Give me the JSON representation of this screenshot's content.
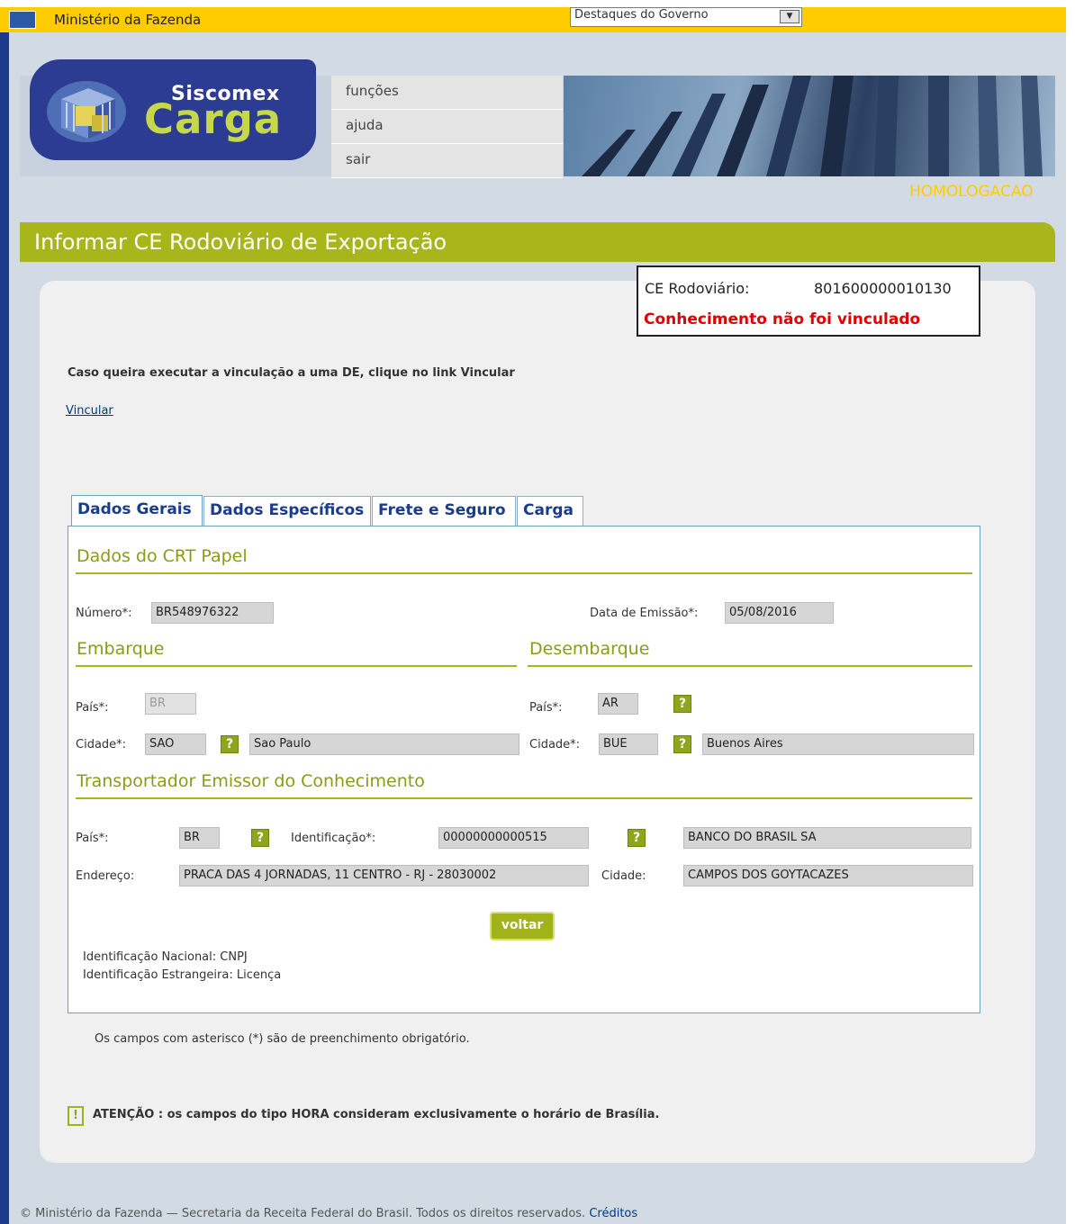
{
  "gov_bar": {
    "title": "Ministério da Fazenda",
    "select_value": "Destaques do Governo",
    "colors": {
      "bar": "#ffcc00",
      "edge": "#1e3a8a"
    }
  },
  "header": {
    "logo_line1": "Siscomex",
    "logo_line2": "Carga",
    "menu": [
      {
        "label": "funções"
      },
      {
        "label": "ajuda"
      },
      {
        "label": "sair"
      }
    ],
    "environment": "HOMOLOGACAO"
  },
  "page": {
    "title": "Informar CE Rodoviário de Exportação",
    "ce_label": "CE Rodoviário:",
    "ce_number": "801600000010130",
    "ce_status": "Conhecimento não foi vinculado",
    "info_text": "Caso queira executar a vinculação a uma DE, clique no link Vincular",
    "vincular_link": "Vincular"
  },
  "tabs": [
    {
      "label": "Dados Gerais",
      "active": true
    },
    {
      "label": "Dados Específicos",
      "active": false
    },
    {
      "label": "Frete e Seguro",
      "active": false
    },
    {
      "label": "Carga",
      "active": false
    }
  ],
  "dados_crt": {
    "section_title": "Dados do CRT Papel",
    "numero_label": "Número*:",
    "numero_value": "BR548976322",
    "data_label": "Data de Emissão*:",
    "data_value": "05/08/2016"
  },
  "embarque": {
    "section_title": "Embarque",
    "pais_label": "País*:",
    "pais_value": "BR",
    "cidade_label": "Cidade*:",
    "cidade_code": "SAO",
    "cidade_name": "Sao Paulo"
  },
  "desembarque": {
    "section_title": "Desembarque",
    "pais_label": "País*:",
    "pais_value": "AR",
    "cidade_label": "Cidade*:",
    "cidade_code": "BUE",
    "cidade_name": "Buenos Aires"
  },
  "transportador": {
    "section_title": "Transportador Emissor do Conhecimento",
    "pais_label": "País*:",
    "pais_value": "BR",
    "ident_label": "Identificação*:",
    "ident_value": "00000000000515",
    "nome_value": "BANCO DO BRASIL SA",
    "endereco_label": "Endereço:",
    "endereco_value": "PRACA DAS 4 JORNADAS, 11 CENTRO - RJ - 28030002",
    "cidade_label": "Cidade:",
    "cidade_value": "CAMPOS DOS GOYTACAZES"
  },
  "help_glyph": "?",
  "buttons": {
    "voltar": "voltar"
  },
  "notes": {
    "ident_nacional": "Identificação Nacional: CNPJ",
    "ident_estrangeira": "Identificação Estrangeira: Licença",
    "obrigatorio": "Os campos com asterisco (*) são de preenchimento obrigatório.",
    "warn_glyph": "!",
    "atencao": "ATENÇÃO : os campos do tipo HORA consideram exclusivamente o horário de Brasília."
  },
  "footer": {
    "text": "© Ministério da Fazenda — Secretaria da Receita Federal do Brasil. Todos os direitos reservados.",
    "link": "Créditos"
  }
}
